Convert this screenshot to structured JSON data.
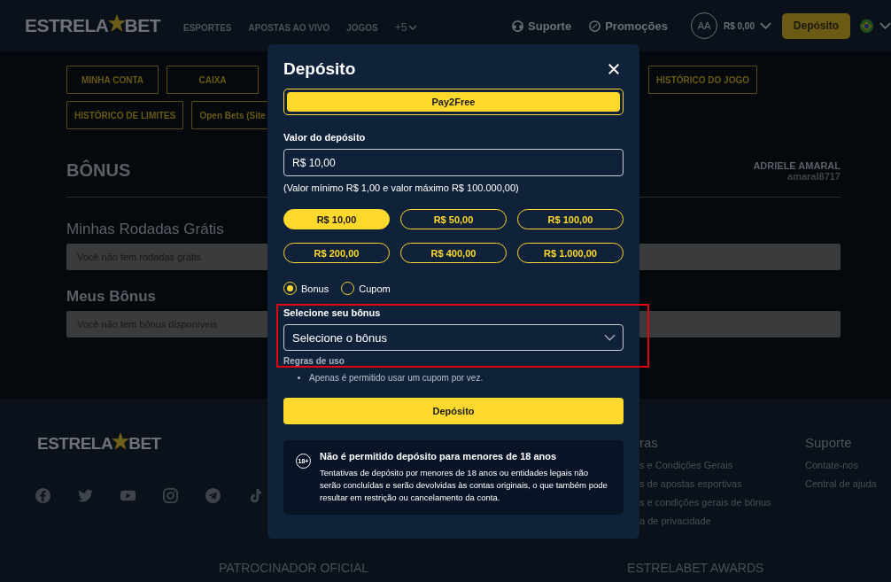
{
  "header": {
    "logo": {
      "left": "ESTRELA",
      "right": "BET"
    },
    "nav": [
      "ESPORTES",
      "APOSTAS AO VIVO",
      "JOGOS",
      "+5"
    ],
    "support": "Suporte",
    "promotions": "Promoções",
    "avatar": "AA",
    "balance": "R$ 0,00",
    "deposit_button": "Depósito"
  },
  "account_tabs": {
    "row_1": [
      "MINHA CONTA",
      "CAIXA",
      "HISTÓRICO DO JOGO"
    ],
    "row_2": [
      "HISTÓRICO DE LIMITES",
      "Open Bets (Site"
    ]
  },
  "bonus_page": {
    "title": "BÔNUS",
    "user_name": "ADRIELE AMARAL",
    "username": "amaral8717",
    "free_spins": {
      "title": "Minhas Rodadas Grátis",
      "empty": "Você não tem rodadas grátis"
    },
    "bonuses": {
      "title": "Meus Bônus",
      "empty": "Você não tem bônus disponíveis"
    }
  },
  "footer": {
    "logo": {
      "left": "ESTRELA",
      "right": "BET"
    },
    "columns": [
      {
        "title": "ras",
        "links": [
          "s e Condições Gerais",
          "s de apostas esportivas",
          "s e condições gerais de bônus",
          "a de privacidade"
        ]
      },
      {
        "title": "Suporte",
        "links": [
          "Contate-nos",
          "Central de ajuda"
        ]
      }
    ],
    "bottom": [
      "PATROCINADOR OFICIAL",
      "ESTRELABET AWARDS"
    ]
  },
  "modal": {
    "title": "Depósito",
    "methods": [
      {
        "label": "Pay2Free",
        "selected": true
      }
    ],
    "amount_label": "Valor do depósito",
    "amount_value": "R$ 10,00",
    "amount_hint": "(Valor mínimo R$ 1,00 e valor máximo R$ 100.000,00)",
    "presets": [
      {
        "label": "R$ 10,00",
        "selected": true
      },
      {
        "label": "R$ 50,00",
        "selected": false
      },
      {
        "label": "R$ 100,00",
        "selected": false
      },
      {
        "label": "R$ 200,00",
        "selected": false
      },
      {
        "label": "R$ 400,00",
        "selected": false
      },
      {
        "label": "R$ 1.000,00",
        "selected": false
      }
    ],
    "options": [
      {
        "label": "Bonus",
        "selected": true
      },
      {
        "label": "Cupom",
        "selected": false
      }
    ],
    "bonus_select": {
      "label": "Selecione seu bônus",
      "placeholder": "Selecione o bônus",
      "highlighted": true
    },
    "rules_title": "Regras de uso",
    "rules": [
      "Apenas é permitido usar um cupom por vez."
    ],
    "submit": "Depósito",
    "notice": {
      "title": "Não é permitido depósito para menores de 18 anos",
      "icon_text": "18+",
      "text": "Tentativas de depósito por menores de 18 anos ou entidades legais não serão concluídas e serão devolvidas às contas originais, o que também pode resultar em restrição ou cancelamento da conta."
    }
  }
}
